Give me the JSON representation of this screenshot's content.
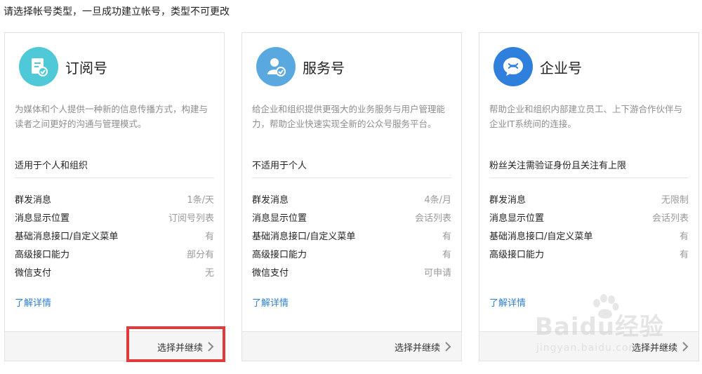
{
  "heading": "请选择帐号类型，一旦成功建立帐号，类型不可更改",
  "cards": [
    {
      "title": "订阅号",
      "icon": "document-check-icon",
      "icon_color": "#4fc9d8",
      "description": "为媒体和个人提供一种新的信息传播方式，构建与读者之间更好的沟通与管理模式。",
      "suitability": "适用于个人和组织",
      "features": [
        {
          "name": "群发消息",
          "value": "1条/天"
        },
        {
          "name": "消息显示位置",
          "value": "订阅号列表"
        },
        {
          "name": "基础消息接口/自定义菜单",
          "value": "有"
        },
        {
          "name": "高级接口能力",
          "value": "部分有"
        },
        {
          "name": "微信支付",
          "value": "无"
        }
      ],
      "more_link": "了解详情",
      "continue_label": "选择并继续"
    },
    {
      "title": "服务号",
      "icon": "user-check-icon",
      "icon_color": "#5aa8e0",
      "description": "给企业和组织提供更强大的业务服务与用户管理能力，帮助企业快速实现全新的公众号服务平台。",
      "suitability": "不适用于个人",
      "features": [
        {
          "name": "群发消息",
          "value": "4条/月"
        },
        {
          "name": "消息显示位置",
          "value": "会话列表"
        },
        {
          "name": "基础消息接口/自定义菜单",
          "value": "有"
        },
        {
          "name": "高级接口能力",
          "value": "有"
        },
        {
          "name": "微信支付",
          "value": "可申请"
        }
      ],
      "more_link": "了解详情",
      "continue_label": "选择并继续"
    },
    {
      "title": "企业号",
      "icon": "enterprise-chat-icon",
      "icon_color": "#2f80dd",
      "description": "帮助企业和组织内部建立员工、上下游合作伙伴与企业IT系统间的连接。",
      "suitability": "粉丝关注需验证身份且关注有上限",
      "features": [
        {
          "name": "群发消息",
          "value": "无限制"
        },
        {
          "name": "消息显示位置",
          "value": "会话列表"
        },
        {
          "name": "基础消息接口/自定义菜单",
          "value": "有"
        },
        {
          "name": "高级接口能力",
          "value": "有"
        }
      ],
      "more_link": "了解详情",
      "continue_label": "选择并继续"
    }
  ],
  "watermark": {
    "logo": "Baidu经验",
    "url": "jingyan.baidu.com"
  },
  "colors": {
    "link": "#2f7fd1",
    "highlight": "#e4393c"
  }
}
